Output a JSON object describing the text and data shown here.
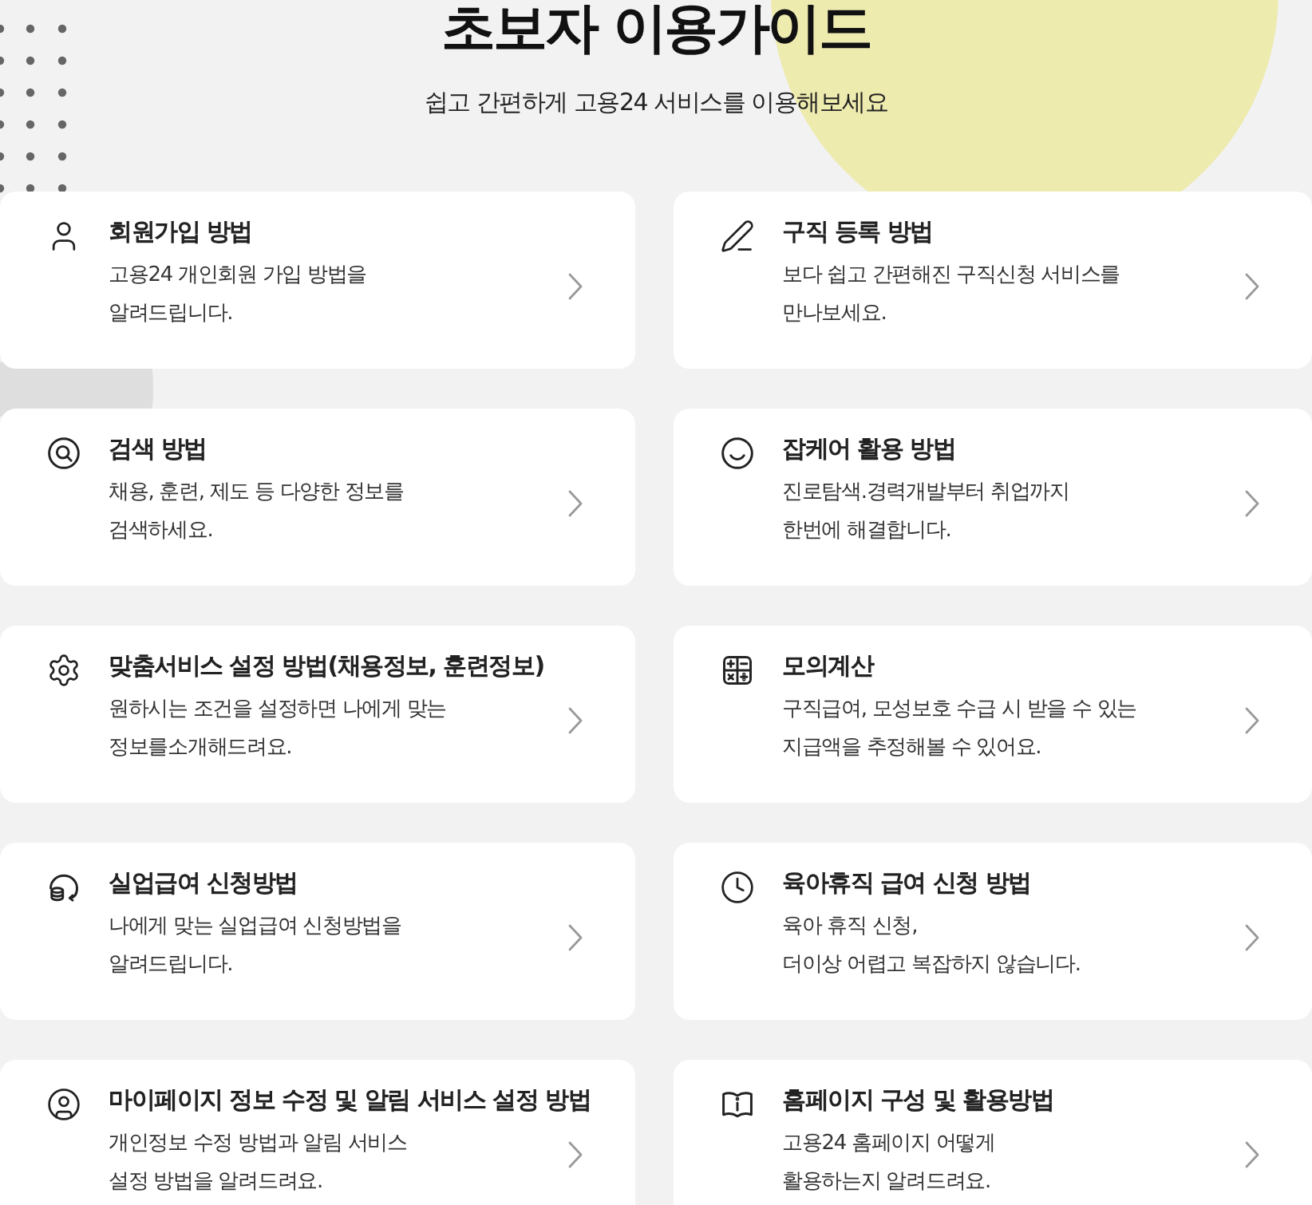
{
  "header": {
    "title": "초보자 이용가이드",
    "subtitle": "쉽고 간편하게 고용24 서비스를 이용해보세요"
  },
  "guides": [
    {
      "title": "회원가입 방법",
      "description": [
        "고용24 개인회원 가입 방법을",
        "알려드립니다."
      ]
    },
    {
      "title": "구직 등록 방법",
      "description": [
        "보다 쉽고 간편해진 구직신청 서비스를",
        "만나보세요."
      ]
    },
    {
      "title": "검색 방법",
      "description": [
        "채용, 훈련, 제도 등 다양한 정보를",
        "검색하세요."
      ]
    },
    {
      "title": "잡케어 활용 방법",
      "description": [
        "진로탐색.경력개발부터 취업까지",
        "한번에 해결합니다."
      ]
    },
    {
      "title": "맞춤서비스 설정 방법(채용정보, 훈련정보)",
      "description": [
        "원하시는 조건을 설정하면 나에게 맞는",
        "정보를소개해드려요."
      ]
    },
    {
      "title": "모의계산",
      "description": [
        "구직급여, 모성보호 수급 시 받을 수 있는",
        "지급액을 추정해볼 수 있어요."
      ]
    },
    {
      "title": "실업급여 신청방법",
      "description": [
        "나에게 맞는 실업급여 신청방법을",
        "알려드립니다."
      ]
    },
    {
      "title": "육아휴직 급여 신청 방법",
      "description": [
        "육아 휴직 신청,",
        "더이상 어렵고 복잡하지 않습니다."
      ]
    },
    {
      "title": "마이페이지 정보 수정 및 알림 서비스 설정 방법",
      "description": [
        "개인정보 수정 방법과 알림 서비스",
        "설정 방법을 알려드려요."
      ]
    },
    {
      "title": "홈페이지 구성 및 활용방법",
      "description": [
        "고용24 홈페이지 어떻게",
        "활용하는지 알려드려요."
      ]
    }
  ]
}
